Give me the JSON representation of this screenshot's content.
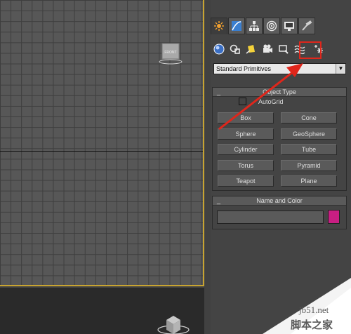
{
  "viewport_top": {
    "cube_label": "FRONT"
  },
  "command_panel": {
    "tabs": [
      {
        "icon": "create-icon",
        "active": true
      },
      {
        "icon": "modify-icon"
      },
      {
        "icon": "hierarchy-icon"
      },
      {
        "icon": "motion-icon"
      },
      {
        "icon": "display-icon"
      },
      {
        "icon": "utilities-icon"
      }
    ],
    "create_categories": [
      {
        "icon": "geometry-icon"
      },
      {
        "icon": "shapes-icon"
      },
      {
        "icon": "lights-icon"
      },
      {
        "icon": "cameras-icon"
      },
      {
        "icon": "helpers-icon"
      },
      {
        "icon": "space-warps-icon"
      },
      {
        "icon": "systems-icon",
        "highlighted": true
      }
    ],
    "category_dropdown": {
      "selected": "Standard Primitives"
    },
    "object_type": {
      "title": "Object Type",
      "collapse": "_",
      "autogrid_label": "AutoGrid",
      "buttons": [
        "Box",
        "Cone",
        "Sphere",
        "GeoSphere",
        "Cylinder",
        "Tube",
        "Torus",
        "Pyramid",
        "Teapot",
        "Plane"
      ]
    },
    "name_and_color": {
      "title": "Name and Color",
      "collapse": "_",
      "name_value": "",
      "color": "#c81e82"
    }
  },
  "annotation": {
    "highlight_color": "#e0261b"
  },
  "watermark": {
    "site": "jb51.net",
    "cn": "脚本之家"
  }
}
